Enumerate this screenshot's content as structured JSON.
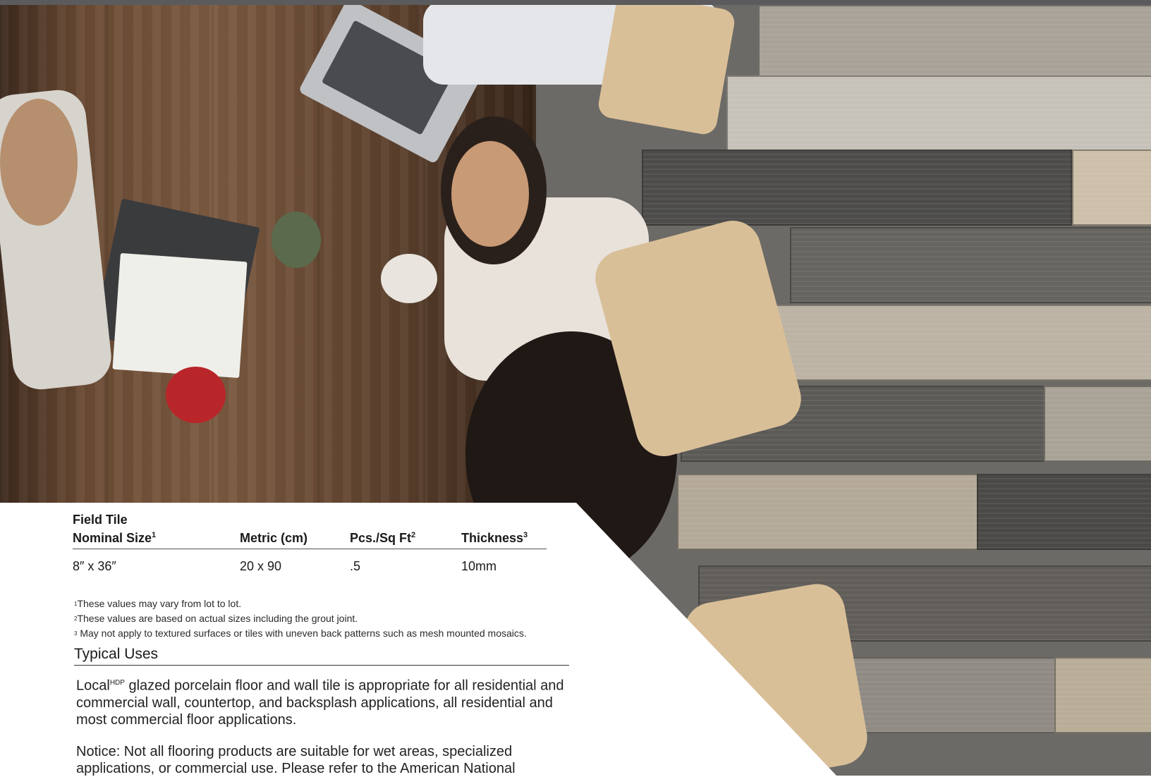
{
  "spec_table": {
    "headers": {
      "nominal_line1": "Field Tile",
      "nominal_line2": "Nominal Size",
      "nominal_sup": "1",
      "metric": "Metric (cm)",
      "pcs": "Pcs./Sq Ft",
      "pcs_sup": "2",
      "thickness": "Thickness",
      "thickness_sup": "3"
    },
    "rows": [
      {
        "nominal": "8″ x 36″",
        "metric": "20 x 90",
        "pcs": ".5",
        "thickness": "10mm"
      }
    ]
  },
  "footnotes": [
    {
      "mark": "1",
      "text": "These values may vary from lot to lot."
    },
    {
      "mark": "2",
      "text": "These values are based on actual sizes including the grout joint."
    },
    {
      "mark": "3",
      "text": "May not apply to textured surfaces or tiles with uneven back patterns such as mesh mounted mosaics."
    }
  ],
  "typical_uses": {
    "title": "Typical Uses",
    "brand": "Local",
    "brand_sup": "HDP",
    "body": " glazed porcelain floor and wall tile is appropriate for all residential and commercial wall, countertop, and backsplash applications, all residential and most commercial floor applications.",
    "notice": "Notice: Not all flooring products are suitable for wet areas, specialized applications, or commercial use. Please refer to the American National"
  },
  "colors": {
    "panel": "#ffffff",
    "text": "#1a1a1a",
    "wood_dark": "#3d2a1d",
    "floor_gray": "#6c6a66"
  }
}
